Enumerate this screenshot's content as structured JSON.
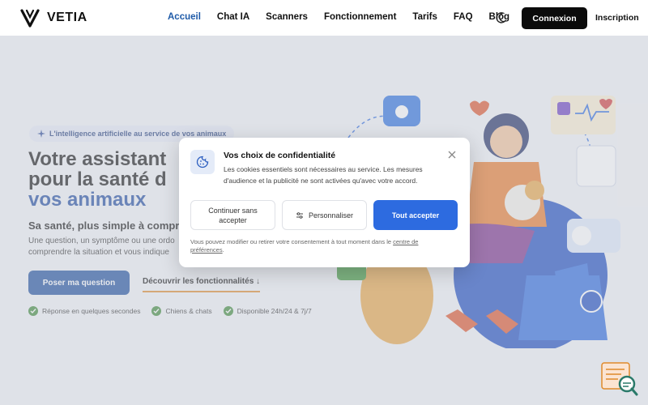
{
  "header": {
    "logo_text": "VETIA",
    "nav": [
      {
        "label": "Accueil"
      },
      {
        "label": "Chat IA"
      },
      {
        "label": "Scanners"
      },
      {
        "label": "Fonctionnement"
      },
      {
        "label": "Tarifs"
      },
      {
        "label": "FAQ"
      },
      {
        "label": "Blog"
      }
    ],
    "login_label": "Connexion",
    "signup_label": "Inscription"
  },
  "hero": {
    "pill": "L'intelligence artificielle au service de vos animaux",
    "title_line1": "Votre assistant",
    "title_line2": "pour la santé d",
    "title_line3": "vos animaux",
    "subtitle": "Sa santé, plus simple à compr",
    "description_line1": "Une question, un symptôme ou une ordo",
    "description_line2": "comprendre la situation et vous indique",
    "cta_primary": "Poser ma question",
    "cta_secondary": "Découvrir les fonctionnalités ↓",
    "features": [
      {
        "label": "Réponse en quelques secondes"
      },
      {
        "label": "Chiens & chats"
      },
      {
        "label": "Disponible 24h/24 & 7j/7"
      }
    ]
  },
  "modal": {
    "title": "Vos choix de confidentialité",
    "text": "Les cookies essentiels sont nécessaires au service. Les mesures d'audience et la publicité ne sont activées qu'avec votre accord.",
    "btn_continue": "Continuer sans accepter",
    "btn_customize": "Personnaliser",
    "btn_accept": "Tout accepter",
    "footer_text": "Vous pouvez modifier ou retirer votre consentement à tout moment dans le ",
    "footer_link": "centre de préférences",
    "footer_end": "."
  },
  "colors": {
    "accent": "#1e4f9e",
    "accept": "#2d6be0",
    "nav_active": "#1e5aa8",
    "check": "#3f8a3a",
    "underline": "#e08a2a"
  },
  "icons": [
    "logo-v-icon",
    "moon-icon",
    "sparkle-icon",
    "check-icon",
    "cookie-icon",
    "close-icon",
    "sliders-icon",
    "search-doc-icon"
  ]
}
